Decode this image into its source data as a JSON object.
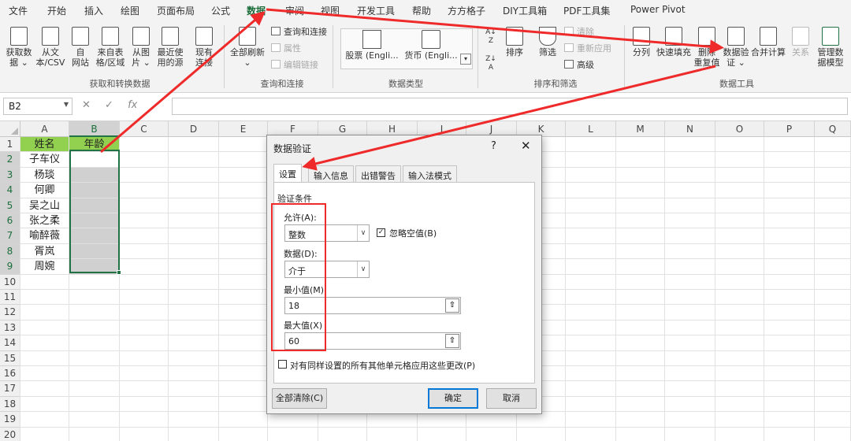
{
  "menu_tabs": [
    "文件",
    "开始",
    "插入",
    "绘图",
    "页面布局",
    "公式",
    "数据",
    "审阅",
    "视图",
    "开发工具",
    "帮助",
    "方方格子",
    "DIY工具箱",
    "PDF工具集",
    "Power Pivot"
  ],
  "ribbon": {
    "get_data": "获取数\n据 ⌄",
    "from_text": "从文\n本/CSV",
    "from_web": "自\n网站",
    "from_table": "来自表\n格/区域",
    "from_picture": "从图\n片 ⌄",
    "recent_sources": "最近使\n用的源",
    "existing_conn": "现有\n连接",
    "refresh_all": "全部刷新\n⌄",
    "queries_conn": "查询和连接",
    "properties": "属性",
    "edit_links": "编辑链接",
    "stocks": "股票 (Engli...",
    "currency": "货币 (Engli...",
    "sort": "排序",
    "filter": "筛选",
    "clear": "清除",
    "reapply": "重新应用",
    "advanced": "高级",
    "text_to_col": "分列",
    "flash_fill": "快速填充",
    "remove_dup": "删除\n重复值",
    "data_validation": "数据验\n证 ⌄",
    "consolidate": "合并计算",
    "relationships": "关系",
    "manage_model": "管理数\n据模型",
    "group_get_transform": "获取和转换数据",
    "group_queries": "查询和连接",
    "group_datatypes": "数据类型",
    "group_sort_filter": "排序和筛选",
    "group_data_tools": "数据工具"
  },
  "formula_bar": {
    "name_box": "B2",
    "cancel": "✕",
    "enter": "✓",
    "fx": "fx",
    "content": ""
  },
  "columns": [
    "A",
    "B",
    "C",
    "D",
    "E",
    "F",
    "G",
    "H",
    "I",
    "J",
    "K",
    "L",
    "M",
    "N",
    "O",
    "P",
    "Q"
  ],
  "rows": [
    "1",
    "2",
    "3",
    "4",
    "5",
    "6",
    "7",
    "8",
    "9",
    "10",
    "11",
    "12",
    "13",
    "14",
    "15",
    "16",
    "17",
    "18",
    "19",
    "20"
  ],
  "cells": {
    "a1": "姓名",
    "b1": "年龄",
    "names": [
      "子车仪",
      "杨琰",
      "何卿",
      "吴之山",
      "张之柔",
      "喻醉薇",
      "胥岚",
      "周婉"
    ]
  },
  "dialog": {
    "title": "数据验证",
    "help": "?",
    "close": "✕",
    "tabs": [
      "设置",
      "输入信息",
      "出错警告",
      "输入法模式"
    ],
    "criteria_label": "验证条件",
    "allow_label": "允许(A):",
    "allow_value": "整数",
    "ignore_blank": "忽略空值(B)",
    "data_label": "数据(D):",
    "data_value": "介于",
    "min_label": "最小值(M)",
    "min_value": "18",
    "max_label": "最大值(X)",
    "max_value": "60",
    "apply_all": "对有同样设置的所有其他单元格应用这些更改(P)",
    "clear_all": "全部清除(C)",
    "ok": "确定",
    "cancel": "取消"
  },
  "colors": {
    "accent_green": "#217346",
    "header_green": "#92d050",
    "annotation_red": "#ee2a2a"
  }
}
